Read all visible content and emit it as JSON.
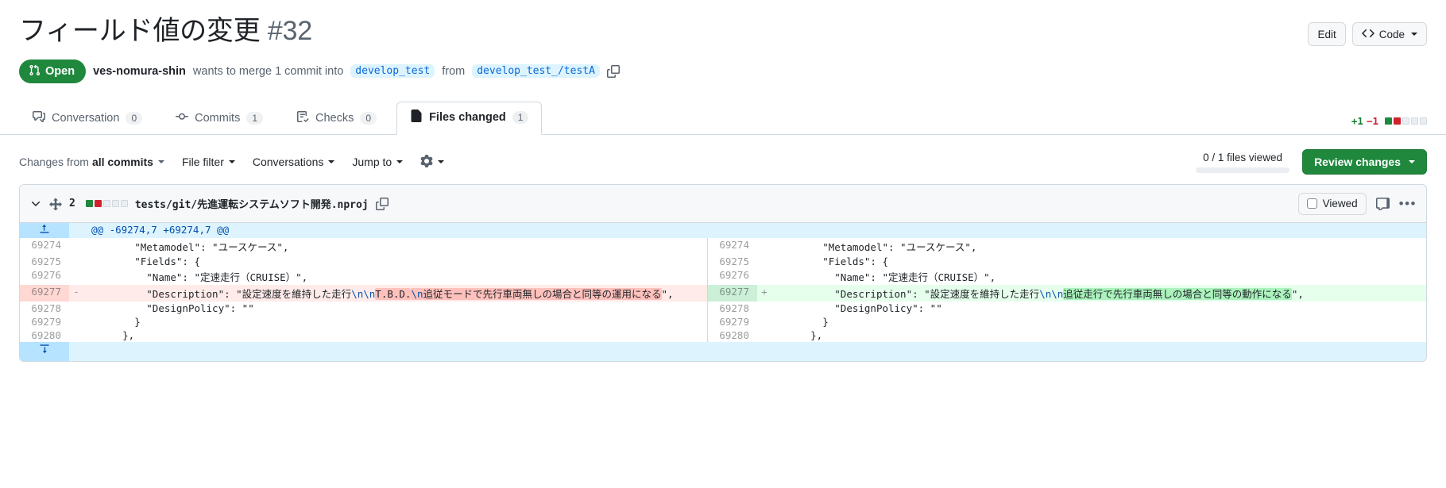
{
  "header": {
    "title": "フィールド値の変更",
    "number": "#32",
    "state": "Open",
    "state_icon": "pull-request-icon",
    "author": "ves-nomura-shin",
    "merge_text_1": "wants to merge 1 commit into",
    "base_branch": "develop_test",
    "merge_text_2": "from",
    "head_branch": "develop_test_/testA",
    "copy_icon": "copy-icon",
    "edit_label": "Edit",
    "code_label": "Code",
    "code_icon": "code-brackets-icon"
  },
  "tabs": [
    {
      "label": "Conversation",
      "count": "0",
      "icon": "comment-discussion-icon",
      "active": false
    },
    {
      "label": "Commits",
      "count": "1",
      "icon": "git-commit-icon",
      "active": false
    },
    {
      "label": "Checks",
      "count": "0",
      "icon": "checklist-icon",
      "active": false
    },
    {
      "label": "Files changed",
      "count": "1",
      "icon": "file-diff-icon",
      "active": true
    }
  ],
  "diffstat": {
    "additions": "+1",
    "deletions": "−1",
    "blocks": [
      "green",
      "red",
      "neutral",
      "neutral",
      "neutral"
    ]
  },
  "toolbar": {
    "changes_prefix": "Changes from",
    "changes_value": "all commits",
    "file_filter": "File filter",
    "conversations": "Conversations",
    "jump_to": "Jump to",
    "settings_icon": "gear-icon",
    "files_viewed": "0 / 1 files viewed",
    "review_changes": "Review changes"
  },
  "file": {
    "collapse_icon": "chevron-down-icon",
    "expand_icon": "unfold-icon",
    "change_count": "2",
    "blocks": [
      "green",
      "red",
      "neutral",
      "neutral",
      "neutral"
    ],
    "path": "tests/git/先進運転システムソフト開発.nproj",
    "copy_icon": "copy-icon",
    "viewed_label": "Viewed",
    "comment_icon": "comment-icon",
    "menu_icon": "kebab-icon"
  },
  "diff": {
    "hunk_header": "@@ -69274,7 +69274,7 @@",
    "expand_up_icon": "expand-up-icon",
    "expand_down_icon": "expand-down-icon",
    "rows": [
      {
        "type": "context",
        "left_num": "69274",
        "right_num": "69274",
        "left_sign": "",
        "right_sign": "",
        "left_code": "        \"Metamodel\": \"ユースケース\",",
        "right_code": "        \"Metamodel\": \"ユースケース\","
      },
      {
        "type": "context",
        "left_num": "69275",
        "right_num": "69275",
        "left_sign": "",
        "right_sign": "",
        "left_code": "        \"Fields\": {",
        "right_code": "        \"Fields\": {"
      },
      {
        "type": "context",
        "left_num": "69276",
        "right_num": "69276",
        "left_sign": "",
        "right_sign": "",
        "left_code": "          \"Name\": \"定速走行（CRUISE）\",",
        "right_code": "          \"Name\": \"定速走行（CRUISE）\","
      },
      {
        "type": "change",
        "left_num": "69277",
        "right_num": "69277",
        "left_sign": "-",
        "right_sign": "+",
        "left_code": "          \"Description\": \"設定速度を維持した走行\\n\\nT.B.D.\\n追従モードで先行車両無しの場合と同等の運用になる\",",
        "right_code": "          \"Description\": \"設定速度を維持した走行\\n\\n追従走行で先行車両無しの場合と同等の動作になる\",",
        "left_parts": [
          {
            "text": "          \"Description\": \"設定速度を維持した走行",
            "hl": false
          },
          {
            "text": "\\n\\n",
            "hl": false,
            "esc": true
          },
          {
            "text": "T.B.D.",
            "hl": true
          },
          {
            "text": "\\n",
            "hl": true,
            "esc": true
          },
          {
            "text": "追従モードで先行車両無しの場合と同等の運用になる",
            "hl": true
          },
          {
            "text": "\",",
            "hl": false
          }
        ],
        "right_parts": [
          {
            "text": "          \"Description\": \"設定速度を維持した走行",
            "hl": false
          },
          {
            "text": "\\n\\n",
            "hl": false,
            "esc": true
          },
          {
            "text": "追従走行で先行車両無しの場合と同等の動作になる",
            "hl": true
          },
          {
            "text": "\",",
            "hl": false
          }
        ]
      },
      {
        "type": "context",
        "left_num": "69278",
        "right_num": "69278",
        "left_sign": "",
        "right_sign": "",
        "left_code": "          \"DesignPolicy\": \"\"",
        "right_code": "          \"DesignPolicy\": \"\""
      },
      {
        "type": "context",
        "left_num": "69279",
        "right_num": "69279",
        "left_sign": "",
        "right_sign": "",
        "left_code": "        }",
        "right_code": "        }"
      },
      {
        "type": "context",
        "left_num": "69280",
        "right_num": "69280",
        "left_sign": "",
        "right_sign": "",
        "left_code": "      },",
        "right_code": "      },"
      }
    ]
  },
  "colors": {
    "green": "#1f883d",
    "red": "#cf222e",
    "blue": "#0969da",
    "muted": "#59636e"
  }
}
